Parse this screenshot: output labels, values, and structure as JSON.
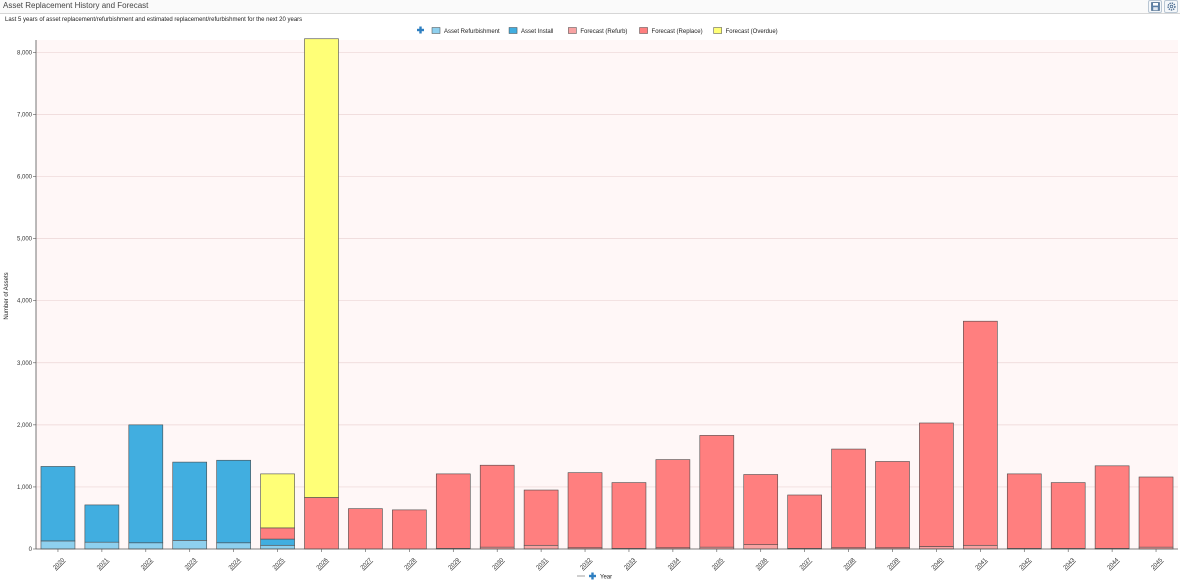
{
  "window": {
    "title": "Asset Replacement History and Forecast",
    "subtitle": "Last 5 years of asset replacement/refurbishment and estimated replacement/refurbishment for the next 20 years",
    "save_icon": "save-icon",
    "settings_icon": "gear-icon"
  },
  "chart_data": {
    "type": "bar",
    "stacked": true,
    "title": "",
    "xlabel": "Year",
    "ylabel": "Number of Assets",
    "ylim": [
      0,
      8200
    ],
    "yticks": [
      0,
      1000,
      2000,
      3000,
      4000,
      5000,
      6000,
      7000,
      8000
    ],
    "ytick_labels": [
      "0",
      "1,000",
      "2,000",
      "3,000",
      "4,000",
      "5,000",
      "6,000",
      "7,000",
      "8,000"
    ],
    "grid": true,
    "legend_position": "top-center",
    "categories": [
      "2020",
      "2021",
      "2022",
      "2023",
      "2024",
      "2025",
      "2026",
      "2027",
      "2028",
      "2029",
      "2030",
      "2031",
      "2032",
      "2033",
      "2034",
      "2035",
      "2036",
      "2037",
      "2038",
      "2039",
      "2040",
      "2041",
      "2042",
      "2043",
      "2044",
      "2045"
    ],
    "series": [
      {
        "name": "Asset Refurbishment",
        "color": "#8ed0ee",
        "values": [
          130,
          110,
          100,
          140,
          100,
          60,
          0,
          0,
          0,
          0,
          0,
          0,
          0,
          0,
          0,
          0,
          0,
          0,
          0,
          0,
          0,
          0,
          0,
          0,
          0,
          0
        ]
      },
      {
        "name": "Asset Install",
        "color": "#41aee0",
        "values": [
          1200,
          600,
          1900,
          1260,
          1330,
          100,
          0,
          0,
          0,
          0,
          0,
          0,
          0,
          0,
          0,
          0,
          0,
          0,
          0,
          0,
          0,
          0,
          0,
          0,
          0,
          0
        ]
      },
      {
        "name": "Forecast (Refurb)",
        "color": "#f8a2a2",
        "values": [
          0,
          0,
          0,
          0,
          0,
          0,
          0,
          0,
          0,
          10,
          30,
          60,
          20,
          10,
          20,
          30,
          70,
          10,
          20,
          20,
          40,
          60,
          10,
          10,
          10,
          30
        ]
      },
      {
        "name": "Forecast (Replace)",
        "color": "#ff7f7f",
        "values": [
          0,
          0,
          0,
          0,
          0,
          180,
          830,
          650,
          630,
          1200,
          1320,
          890,
          1210,
          1060,
          1420,
          1800,
          1130,
          860,
          1590,
          1390,
          1990,
          3610,
          1200,
          1060,
          1330,
          1130
        ]
      },
      {
        "name": "Forecast (Overdue)",
        "color": "#ffff77",
        "values": [
          0,
          0,
          0,
          0,
          0,
          870,
          7390,
          0,
          0,
          0,
          0,
          0,
          0,
          0,
          0,
          0,
          0,
          0,
          0,
          0,
          0,
          0,
          0,
          0,
          0,
          0
        ]
      }
    ]
  }
}
